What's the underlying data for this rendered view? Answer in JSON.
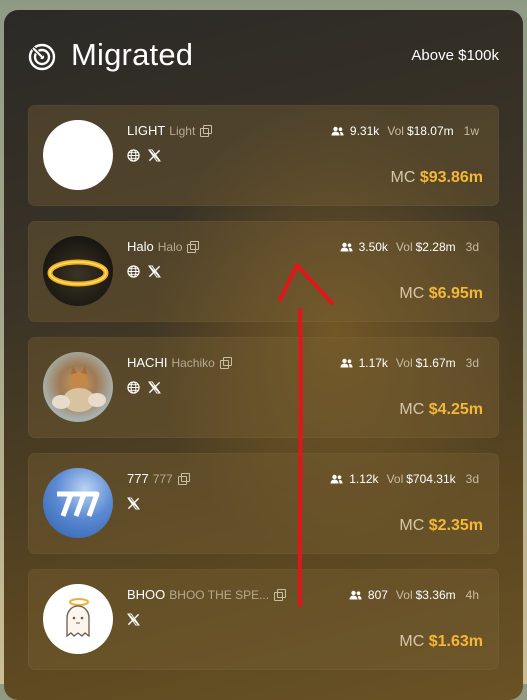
{
  "header": {
    "title": "Migrated",
    "filter": "Above $100k"
  },
  "labels": {
    "vol": "Vol",
    "mc": "MC"
  },
  "tokens": [
    {
      "name": "LIGHT",
      "ticker": "Light",
      "holders": "9.31k",
      "vol": "$18.07m",
      "age": "1w",
      "mc": "$93.86m",
      "has_globe": true,
      "avatar": "white-circle"
    },
    {
      "name": "Halo",
      "ticker": "Halo",
      "holders": "3.50k",
      "vol": "$2.28m",
      "age": "3d",
      "mc": "$6.95m",
      "has_globe": true,
      "avatar": "golden-halo-ring"
    },
    {
      "name": "HACHI",
      "ticker": "Hachiko",
      "holders": "1.17k",
      "vol": "$1.67m",
      "age": "3d",
      "mc": "$4.25m",
      "has_globe": true,
      "avatar": "dog-painting"
    },
    {
      "name": "777",
      "ticker": "777",
      "holders": "1.12k",
      "vol": "$704.31k",
      "age": "3d",
      "mc": "$2.35m",
      "has_globe": false,
      "avatar": "777-sky"
    },
    {
      "name": "BHOO",
      "ticker": "BHOO THE SPE...",
      "holders": "807",
      "vol": "$3.36m",
      "age": "4h",
      "mc": "$1.63m",
      "has_globe": false,
      "avatar": "ghost-with-halo"
    }
  ],
  "colors": {
    "accent_gold": "#f4b73a",
    "annotation_red": "#e0161b"
  }
}
